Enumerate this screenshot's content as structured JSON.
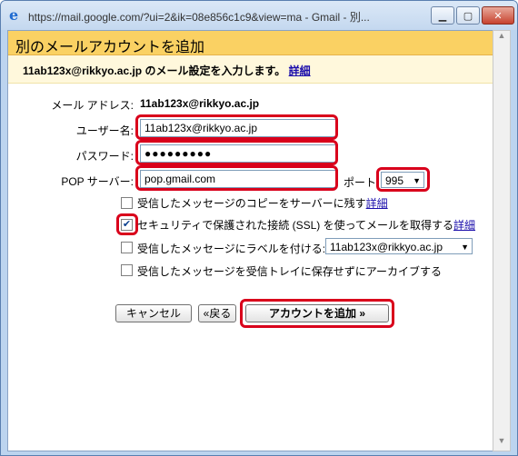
{
  "window": {
    "title": "https://mail.google.com/?ui=2&ik=08e856c1c9&view=ma - Gmail - 別..."
  },
  "dialog": {
    "heading": "別のメールアカウントを追加",
    "subheading": "11ab123x@rikkyo.ac.jp のメール設定を入力します。",
    "details_link": "詳細"
  },
  "form": {
    "email_label": "メール アドレス:",
    "email_value": "11ab123x@rikkyo.ac.jp",
    "username_label": "ユーザー名:",
    "username_value": "11ab123x@rikkyo.ac.jp",
    "password_label": "パスワード:",
    "password_value": "●●●●●●●●●",
    "pop_label": "POP サーバー:",
    "pop_value": "pop.gmail.com",
    "port_label": "ポート:",
    "port_value": "995"
  },
  "options": [
    {
      "label": "受信したメッセージのコピーをサーバーに残す",
      "link": "詳細",
      "checked": false
    },
    {
      "label": "セキュリティで保護された接続 (SSL) を使ってメールを取得する",
      "link": "詳細",
      "checked": true
    },
    {
      "label": "受信したメッセージにラベルを付ける:",
      "select": "11ab123x@rikkyo.ac.jp",
      "checked": false
    },
    {
      "label": "受信したメッセージを受信トレイに保存せずにアーカイブする",
      "checked": false
    }
  ],
  "buttons": {
    "cancel": "キャンセル",
    "back": "«戻る",
    "add": "アカウントを追加 »"
  },
  "colors": {
    "header": "#fad163",
    "highlight": "#d9001b"
  }
}
